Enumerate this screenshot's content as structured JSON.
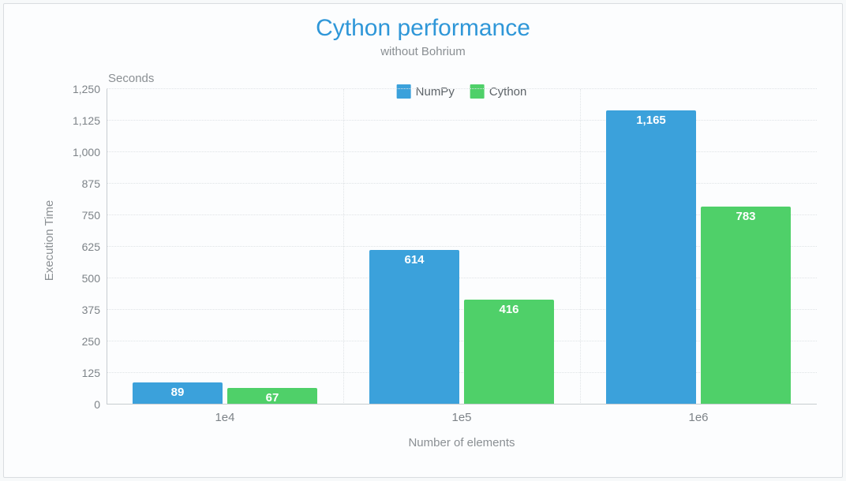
{
  "chart_data": {
    "type": "bar",
    "title": "Cython performance",
    "subtitle": "without Bohrium",
    "xlabel": "Number of elements",
    "ylabel": "Execution Time",
    "unit_label": "Seconds",
    "categories": [
      "1e4",
      "1e5",
      "1e6"
    ],
    "series": [
      {
        "name": "NumPy",
        "values": [
          89,
          614,
          1165
        ],
        "color": "#3ba1db"
      },
      {
        "name": "Cython",
        "values": [
          67,
          416,
          783
        ],
        "color": "#4fd069"
      }
    ],
    "ylim": [
      0,
      1250
    ],
    "yticks": [
      0,
      125,
      250,
      375,
      500,
      625,
      750,
      875,
      1000,
      1125,
      1250
    ],
    "ytick_labels": [
      "0",
      "125",
      "250",
      "375",
      "500",
      "625",
      "750",
      "875",
      "1,000",
      "1,125",
      "1,250"
    ],
    "value_labels": {
      "NumPy": [
        "89",
        "614",
        "1,165"
      ],
      "Cython": [
        "67",
        "416",
        "783"
      ]
    }
  }
}
